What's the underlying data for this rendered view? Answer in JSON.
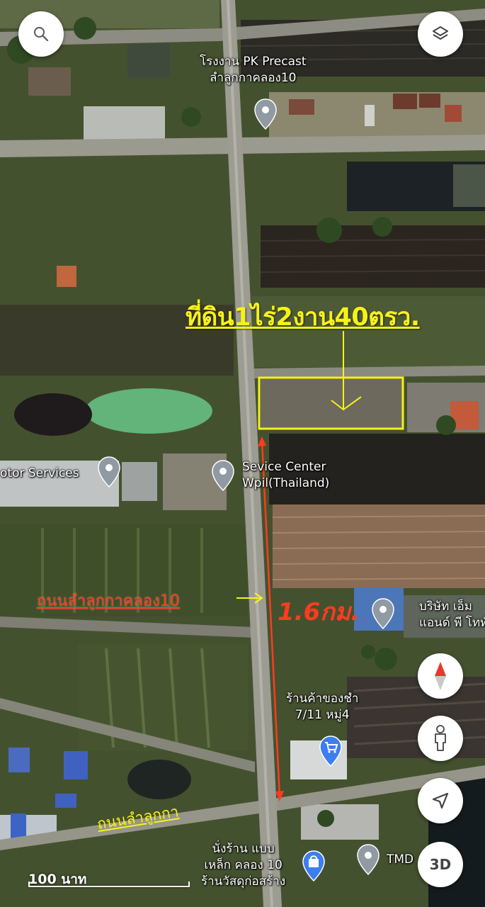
{
  "map": {
    "controls": {
      "search_icon": "search-icon",
      "layers_icon": "layers-icon",
      "compass_icon": "compass-icon",
      "street_view_icon": "pegman-icon",
      "my_location_icon": "navigation-arrow-icon",
      "three_d_label": "3D"
    },
    "places": {
      "pk_precast_line1": "โรงงาน PK Precast",
      "pk_precast_line2": "ลำลูกกาคลอง10",
      "motor_services": "otor Services",
      "service_center_line1": "Sevice Center",
      "service_center_line2": "Wpil(Thailand)",
      "company_line1": "บริษัท เอ็ม",
      "company_line2": "แอนด์ พี โททัล",
      "store_line1": "ร้านค้าของชำ",
      "store_line2": "7/11 หมู่4",
      "tmd": "TMD",
      "shop_line1": "นั่งร้าน แบบ",
      "shop_line2": "เหล็ก คลอง 10",
      "shop_line3": "ร้านวัสดุก่อสร้าง"
    },
    "scale_label": "100 นาท"
  },
  "annotations": {
    "title": "ที่ดิน1ไร่2งาน40ตรว.",
    "road_main": "ถนนลำลูกกาคลอง10",
    "road_main_arrow": "→",
    "distance": "1.6กม.",
    "road_bottom": "ถนนลำลูกกา",
    "colors": {
      "highlight": "#f6f21a",
      "measure": "#ff3b1f"
    }
  }
}
